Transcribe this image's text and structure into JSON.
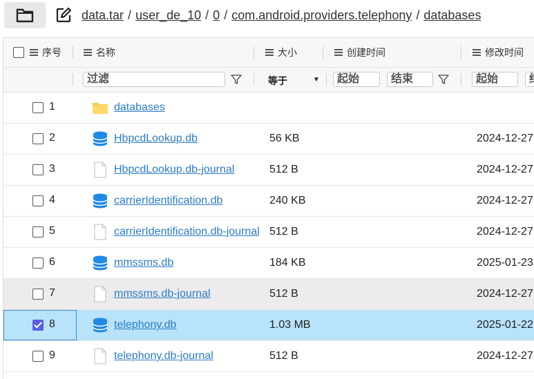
{
  "toolbar": {
    "folder_icon": "folder-icon",
    "edit_icon": "edit-icon"
  },
  "breadcrumb": [
    "data.tar",
    "user_de_10",
    "0",
    "com.android.providers.telephony",
    "databases"
  ],
  "breadcrumb_separator": "/",
  "columns": {
    "seq": "序号",
    "name": "名称",
    "size": "大小",
    "created": "创建时间",
    "modified": "修改时间"
  },
  "filters": {
    "name_placeholder": "过滤",
    "size_op": "等于",
    "created_start": "起始",
    "created_end": "结束",
    "modified_start": "起始",
    "modified_end_partial": "结"
  },
  "rows": [
    {
      "idx": "1",
      "type": "folder",
      "name": "databases",
      "size": "",
      "date": "",
      "checked": false,
      "state": "normal"
    },
    {
      "idx": "2",
      "type": "db",
      "name": "HbpcdLookup.db",
      "size": "56 KB",
      "date": "2024-12-27",
      "checked": false,
      "state": "normal"
    },
    {
      "idx": "3",
      "type": "file",
      "name": "HbpcdLookup.db-journal",
      "size": "512 B",
      "date": "2024-12-27",
      "checked": false,
      "state": "normal"
    },
    {
      "idx": "4",
      "type": "db",
      "name": "carrierIdentification.db",
      "size": "240 KB",
      "date": "2024-12-27",
      "checked": false,
      "state": "normal"
    },
    {
      "idx": "5",
      "type": "file",
      "name": "carrierIdentification.db-journal",
      "size": "512 B",
      "date": "2024-12-27",
      "checked": false,
      "state": "normal"
    },
    {
      "idx": "6",
      "type": "db",
      "name": "mmssms.db",
      "size": "184 KB",
      "date": "2025-01-23",
      "checked": false,
      "state": "normal"
    },
    {
      "idx": "7",
      "type": "file",
      "name": "mmssms.db-journal",
      "size": "512 B",
      "date": "2024-12-27",
      "checked": false,
      "state": "hover"
    },
    {
      "idx": "8",
      "type": "db",
      "name": "telephony.db",
      "size": "1.03 MB",
      "date": "2025-01-22",
      "checked": true,
      "state": "selected"
    },
    {
      "idx": "9",
      "type": "file",
      "name": "telephony.db-journal",
      "size": "512 B",
      "date": "2024-12-27",
      "checked": false,
      "state": "normal"
    }
  ],
  "colors": {
    "link": "#2b7cc7",
    "selected_row": "#b9e3fb",
    "hover_row": "#ececec",
    "checkbox_checked": "#5a5ee0",
    "db_icon": "#1e88e5",
    "folder_icon": "#f9c74f"
  }
}
